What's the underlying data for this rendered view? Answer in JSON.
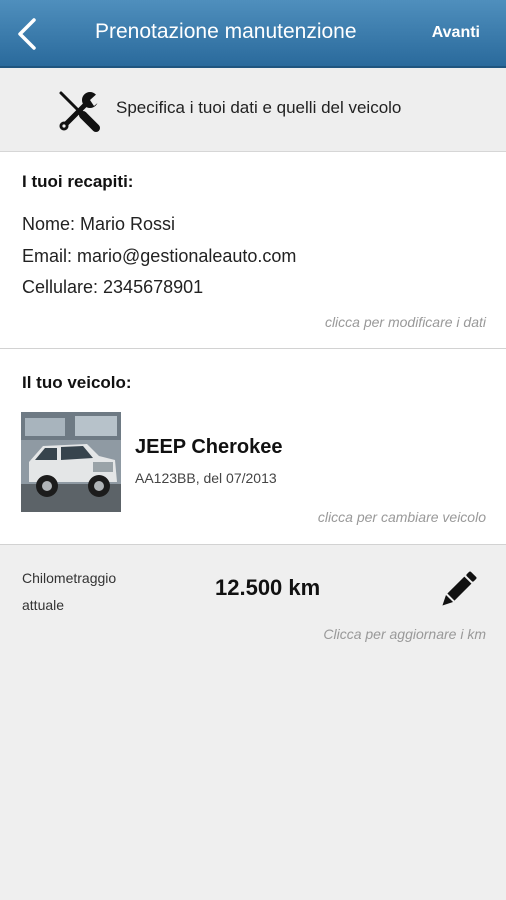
{
  "header": {
    "title": "Prenotazione manutenzione",
    "next_label": "Avanti",
    "back_icon": "chevron-left-icon"
  },
  "intro": {
    "icon": "tools-icon",
    "text": "Specifica i tuoi dati e quelli del veicolo"
  },
  "contacts": {
    "title": "I tuoi recapiti:",
    "name": "Nome: Mario Rossi",
    "email": "Email: mario@gestionaleauto.com",
    "phone": "Cellulare: 2345678901",
    "hint": "clicca per modificare i dati"
  },
  "vehicle": {
    "title": "Il tuo veicolo:",
    "name": "JEEP Cherokee",
    "plate": "AA123BB, del 07/2013",
    "hint": "clicca per cambiare veicolo"
  },
  "mileage": {
    "label": "Chilometraggio attuale",
    "value": "12.500 km",
    "hint": "Clicca per aggiornare i km",
    "icon": "pencil-icon"
  },
  "colors": {
    "header": "#3a7bad",
    "background": "#efefef",
    "card": "#ffffff",
    "hint": "#999999"
  }
}
